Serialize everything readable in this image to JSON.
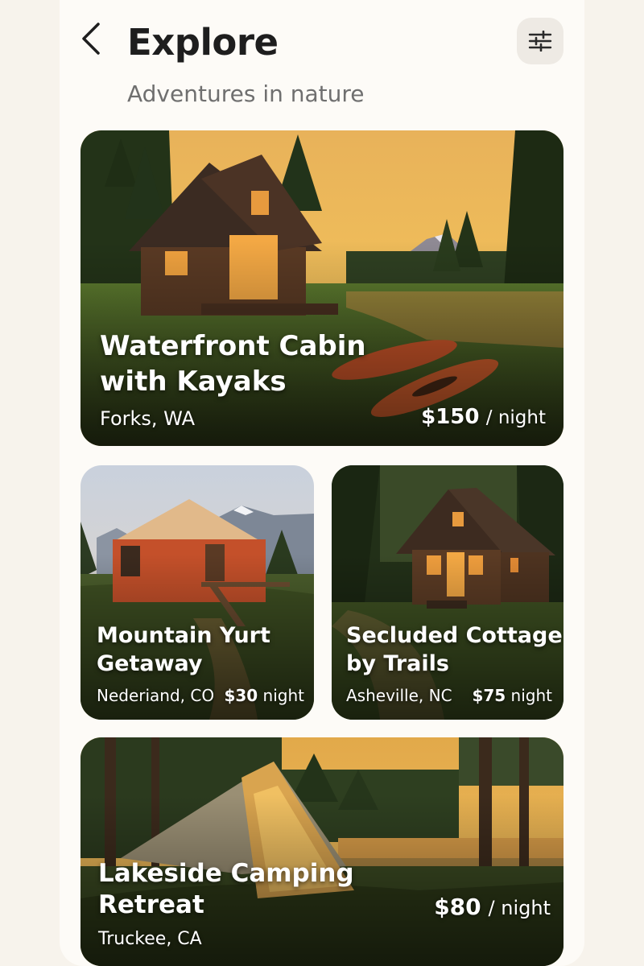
{
  "header": {
    "title": "Explore",
    "subtitle": "Adventures in nature",
    "back_icon": "chevron-left-icon",
    "filter_icon": "sliders-icon"
  },
  "listings": [
    {
      "title_line1": "Waterfront Cabin",
      "title_line2": "with Kayaks",
      "location": "Forks, WA",
      "price": "$150",
      "unit": "/ night"
    },
    {
      "title_line1": "Mountain Yurt",
      "title_line2": "Getaway",
      "location": "Nederiand, CO",
      "price": "$30",
      "unit": "night"
    },
    {
      "title_line1": "Secluded Cottage",
      "title_line2": "by Trails",
      "location": "Asheville, NC",
      "price": "$75",
      "unit": "night"
    },
    {
      "title_line1": "Lakeside Camping",
      "title_line2": "Retreat",
      "location": "Truckee, CA",
      "price": "$80",
      "unit": "/ night"
    }
  ]
}
